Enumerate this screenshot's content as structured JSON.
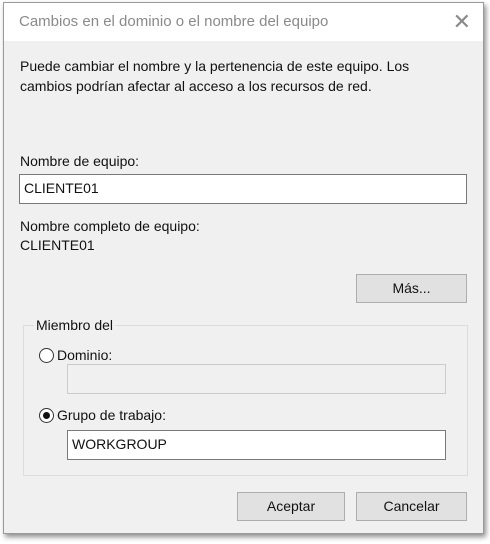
{
  "window": {
    "title": "Cambios en el dominio o el nombre del equipo",
    "close_icon": "close-icon"
  },
  "description": [
    "Puede cambiar el nombre y la pertenencia de este equipo. Los",
    "cambios podrían afectar al acceso a los recursos de red."
  ],
  "computer_name": {
    "label": "Nombre de equipo:",
    "value": "CLIENTE01"
  },
  "full_name": {
    "label": "Nombre completo de equipo:",
    "value": "CLIENTE01"
  },
  "more_button": "Más...",
  "member_of": {
    "legend": "Miembro del",
    "domain": {
      "label": "Dominio:",
      "value": "",
      "selected": false
    },
    "workgroup": {
      "label": "Grupo de trabajo:",
      "value": "WORKGROUP",
      "selected": true
    }
  },
  "buttons": {
    "ok": "Aceptar",
    "cancel": "Cancelar"
  }
}
